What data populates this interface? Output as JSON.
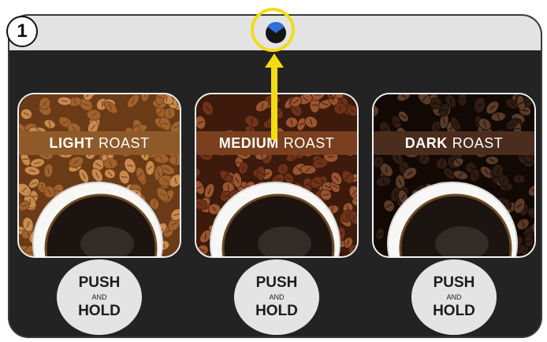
{
  "step": {
    "number": "1"
  },
  "status_indicator": {
    "icon": "status-light-icon",
    "highlight_color": "#f2dc14"
  },
  "cards": [
    {
      "strength": "LIGHT",
      "word": "ROAST",
      "band_color": "#8f5a2a",
      "bean_base": "#a0622d",
      "bean_dark": "#6b3a16",
      "bean_light": "#c88a4e"
    },
    {
      "strength": "MEDIUM",
      "word": "ROAST",
      "band_color": "#7a3f1e",
      "bean_base": "#6f331a",
      "bean_dark": "#3d1a0b",
      "bean_light": "#9a5430"
    },
    {
      "strength": "DARK",
      "word": "ROAST",
      "band_color": "#4a2d1c",
      "bean_base": "#2f1c12",
      "bean_dark": "#120904",
      "bean_light": "#5a3a28"
    }
  ],
  "buttons": [
    {
      "line1": "PUSH",
      "line2": "AND",
      "line3": "HOLD"
    },
    {
      "line1": "PUSH",
      "line2": "AND",
      "line3": "HOLD"
    },
    {
      "line1": "PUSH",
      "line2": "AND",
      "line3": "HOLD"
    }
  ]
}
